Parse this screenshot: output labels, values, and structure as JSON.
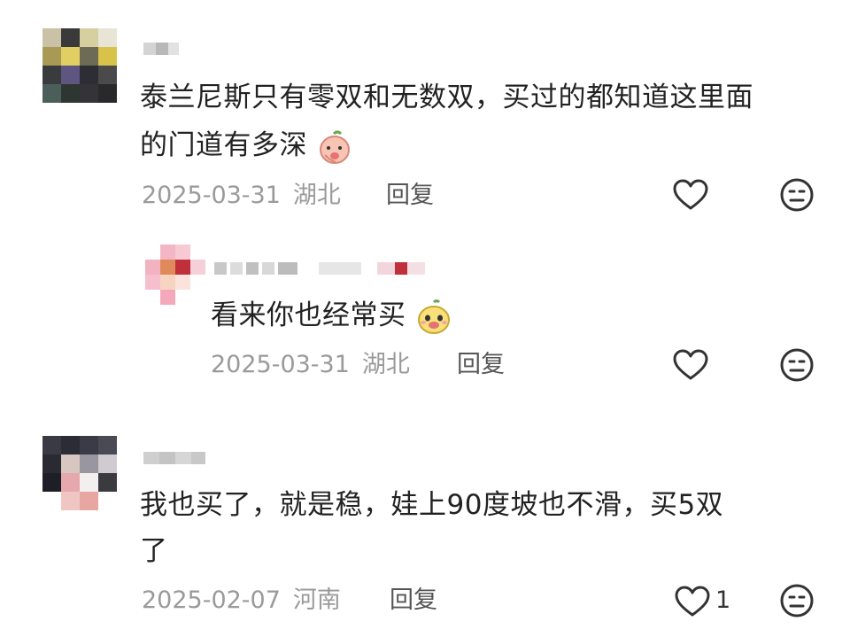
{
  "comments": [
    {
      "text_line1": "泰兰尼斯只有零双和无数双，买过的都知道这里面",
      "text_line2": "的门道有多深",
      "date": "2025-03-31",
      "location": "湖北",
      "reply_label": "回复",
      "like_count": ""
    },
    {
      "text_line1": "看来你也经常买",
      "date": "2025-03-31",
      "location": "湖北",
      "reply_label": "回复",
      "like_count": ""
    },
    {
      "text_line1": "我也买了，就是稳，娃上90度坡也不滑，买5双",
      "text_line2": "了",
      "date": "2025-02-07",
      "location": "河南",
      "reply_label": "回复",
      "like_count": "1"
    }
  ],
  "icons": {
    "like": "heart-outline-icon",
    "dislike": "neutral-face-icon",
    "emoji1": "peach-emoji",
    "emoji2": "yellow-face-emoji"
  },
  "colors": {
    "text": "#222222",
    "meta": "#9a9a9a",
    "icon": "#333333"
  }
}
